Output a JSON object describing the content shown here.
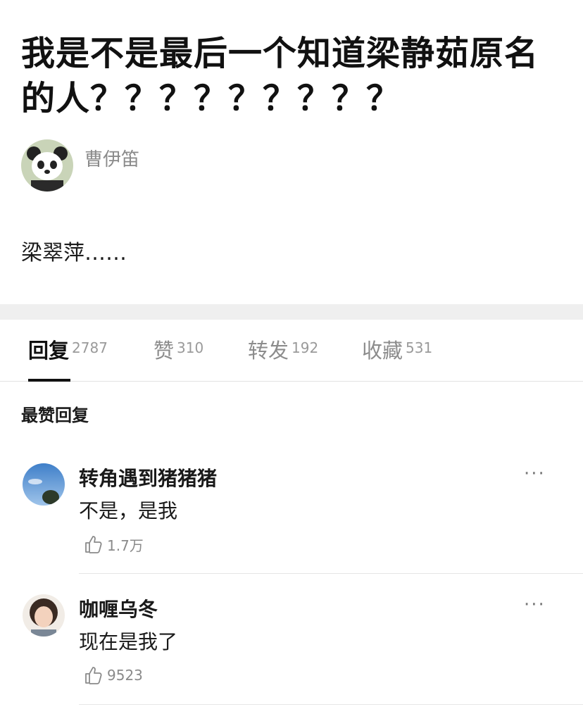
{
  "post": {
    "title": "我是不是最后一个知道梁静茹原名的人？？？？？？？？？",
    "author": "曹伊笛",
    "body": "梁翠萍……"
  },
  "tabs": [
    {
      "label": "回复",
      "count": "2787",
      "active": true
    },
    {
      "label": "赞",
      "count": "310",
      "active": false
    },
    {
      "label": "转发",
      "count": "192",
      "active": false
    },
    {
      "label": "收藏",
      "count": "531",
      "active": false
    }
  ],
  "comments_section": {
    "heading": "最赞回复"
  },
  "comments": [
    {
      "user": "转角遇到猪猪猪",
      "text": "不是，是我",
      "likes": "1.7万",
      "more": "···"
    },
    {
      "user": "咖喱乌冬",
      "text": "现在是我了",
      "likes": "9523",
      "more": "···"
    }
  ],
  "icons": {
    "like": "thumbs-up-icon",
    "more": "more-dots-icon"
  },
  "colors": {
    "divider_band": "#efefef",
    "muted_text": "#8a8a8a",
    "active_tab": "#111111"
  }
}
